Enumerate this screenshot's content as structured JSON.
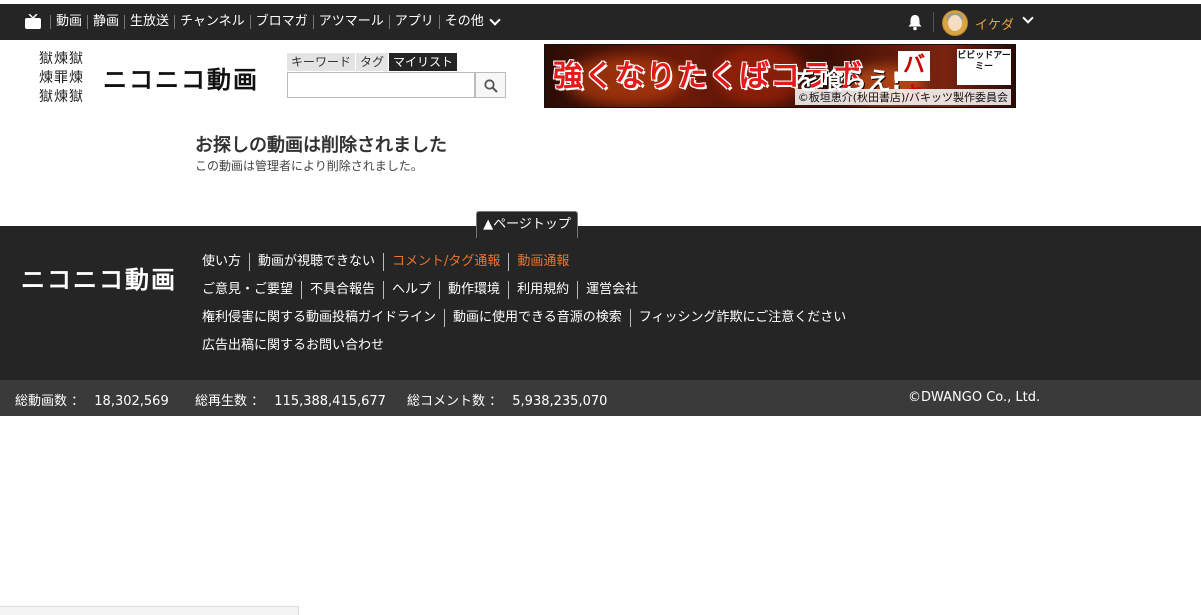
{
  "nav": {
    "items": [
      "動画",
      "静画",
      "生放送",
      "チャンネル",
      "ブロマガ",
      "アツマール",
      "アプリ"
    ],
    "more_label": "その他",
    "username": "イケダ",
    "colors": {
      "bar": "#252525",
      "username": "#e8a33a"
    }
  },
  "header": {
    "kanji_logo_lines": [
      "獄煉獄",
      "煉罪煉",
      "獄煉獄"
    ],
    "logo": "ニコニコ動画",
    "search_tabs": [
      "キーワード",
      "タグ",
      "マイリスト"
    ],
    "active_search_tab": "マイリスト",
    "search_value": "",
    "search_placeholder": ""
  },
  "ad": {
    "headline": "強くなりたくばコラボ",
    "eat": "を喰らえ!",
    "badge": "バキ",
    "vivid": "ビビッドアーミー",
    "credit": "©板垣恵介(秋田書店)/バキッツ製作委員会"
  },
  "message": {
    "title": "お探しの動画は削除されました",
    "body": "この動画は管理者により削除されました。"
  },
  "footer": {
    "page_top": "▲ページトップ",
    "logo": "ニコニコ動画",
    "rows": [
      [
        {
          "label": "使い方",
          "accent": false
        },
        {
          "label": "動画が視聴できない",
          "accent": false
        },
        {
          "label": "コメント/タグ通報",
          "accent": true
        },
        {
          "label": "動画通報",
          "accent": true
        }
      ],
      [
        {
          "label": "ご意見・ご要望",
          "accent": false
        },
        {
          "label": "不具合報告",
          "accent": false
        },
        {
          "label": "ヘルプ",
          "accent": false
        },
        {
          "label": "動作環境",
          "accent": false
        },
        {
          "label": "利用規約",
          "accent": false
        },
        {
          "label": "運営会社",
          "accent": false
        }
      ],
      [
        {
          "label": "権利侵害に関する動画投稿ガイドライン",
          "accent": false
        },
        {
          "label": "動画に使用できる音源の検索",
          "accent": false
        },
        {
          "label": "フィッシング詐欺にご注意ください",
          "accent": false
        }
      ],
      [
        {
          "label": "広告出稿に関するお問い合わせ",
          "accent": false
        }
      ]
    ],
    "accent_color": "#e9762b"
  },
  "stats": {
    "videos_label": "総動画数 ：",
    "videos_value": "18,302,569",
    "plays_label": "総再生数 ：",
    "plays_value": "115,388,415,677",
    "comments_label": "総コメント数 ：",
    "comments_value": "5,938,235,070",
    "copyright": "©DWANGO Co., Ltd."
  }
}
